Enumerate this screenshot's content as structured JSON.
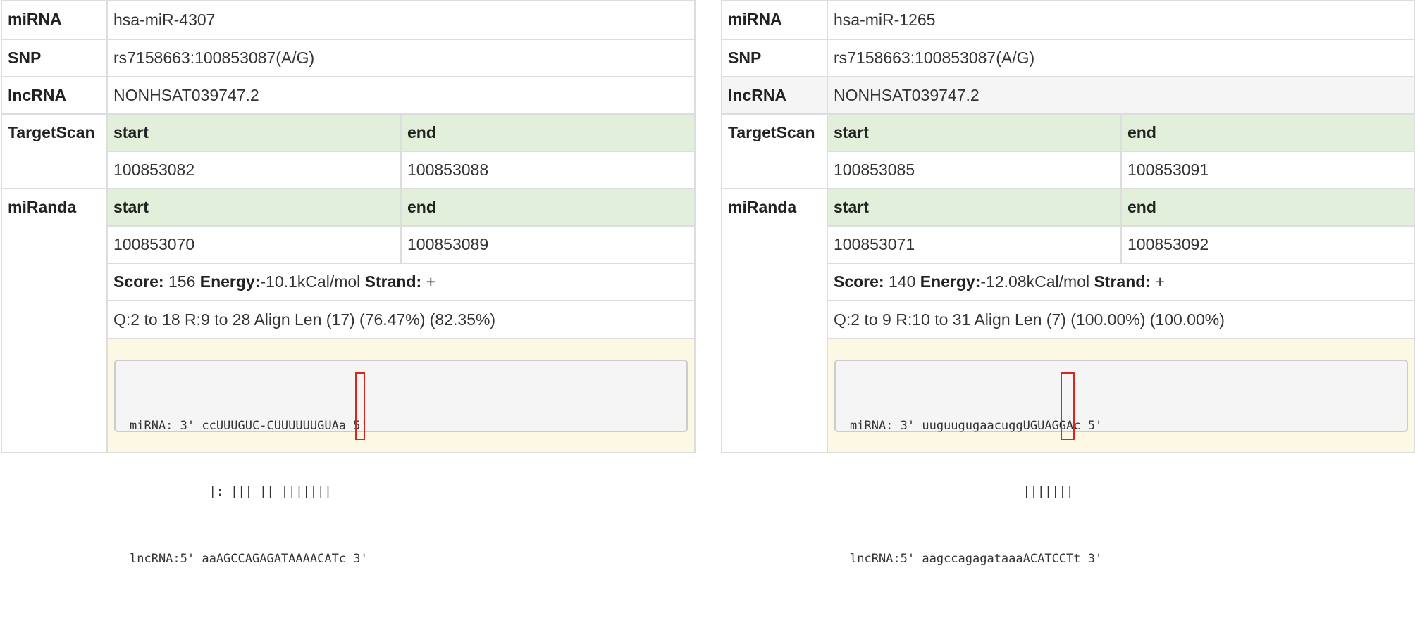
{
  "labels": {
    "mirna": "miRNA",
    "snp": "SNP",
    "lncrna": "lncRNA",
    "targetscan": "TargetScan",
    "miranda": "miRanda",
    "start": "start",
    "end": "end",
    "score": "Score:",
    "energy": "Energy:",
    "strand": "Strand:"
  },
  "panels": [
    {
      "mirna": "hsa-miR-4307",
      "snp": "rs7158663:100853087(A/G)",
      "lncrna": "NONHSAT039747.2",
      "targetscan": {
        "start": "100853082",
        "end": "100853088"
      },
      "miranda": {
        "start": "100853070",
        "end": "100853089"
      },
      "score": "156",
      "energy": "-10.1kCal/mol",
      "strand": "+",
      "align_summary": "Q:2 to 18 R:9 to 28 Align Len (17) (76.47%) (82.35%)",
      "alignment": [
        "miRNA: 3' ccUUUGUC-CUUUUUUGUAa 5'",
        "           |: ||| || |||||||",
        "lncRNA:5' aaAGCCAGAGATAAAACATc 3'"
      ]
    },
    {
      "mirna": "hsa-miR-1265",
      "snp": "rs7158663:100853087(A/G)",
      "lncrna": "NONHSAT039747.2",
      "targetscan": {
        "start": "100853085",
        "end": "100853091"
      },
      "miranda": {
        "start": "100853071",
        "end": "100853092"
      },
      "score": "140",
      "energy": "-12.08kCal/mol",
      "strand": "+",
      "align_summary": "Q:2 to 9 R:10 to 31 Align Len (7) (100.00%) (100.00%)",
      "alignment": [
        "miRNA: 3' uuguugugaacuggUGUAGGAc 5'",
        "                        |||||||",
        "lncRNA:5' aagccagagataaaACATCCTt 3'"
      ]
    }
  ],
  "colors": {
    "header_green": "#e2efda",
    "alignment_yellow": "#fcf8e3",
    "snp_box": "#d9261c"
  }
}
